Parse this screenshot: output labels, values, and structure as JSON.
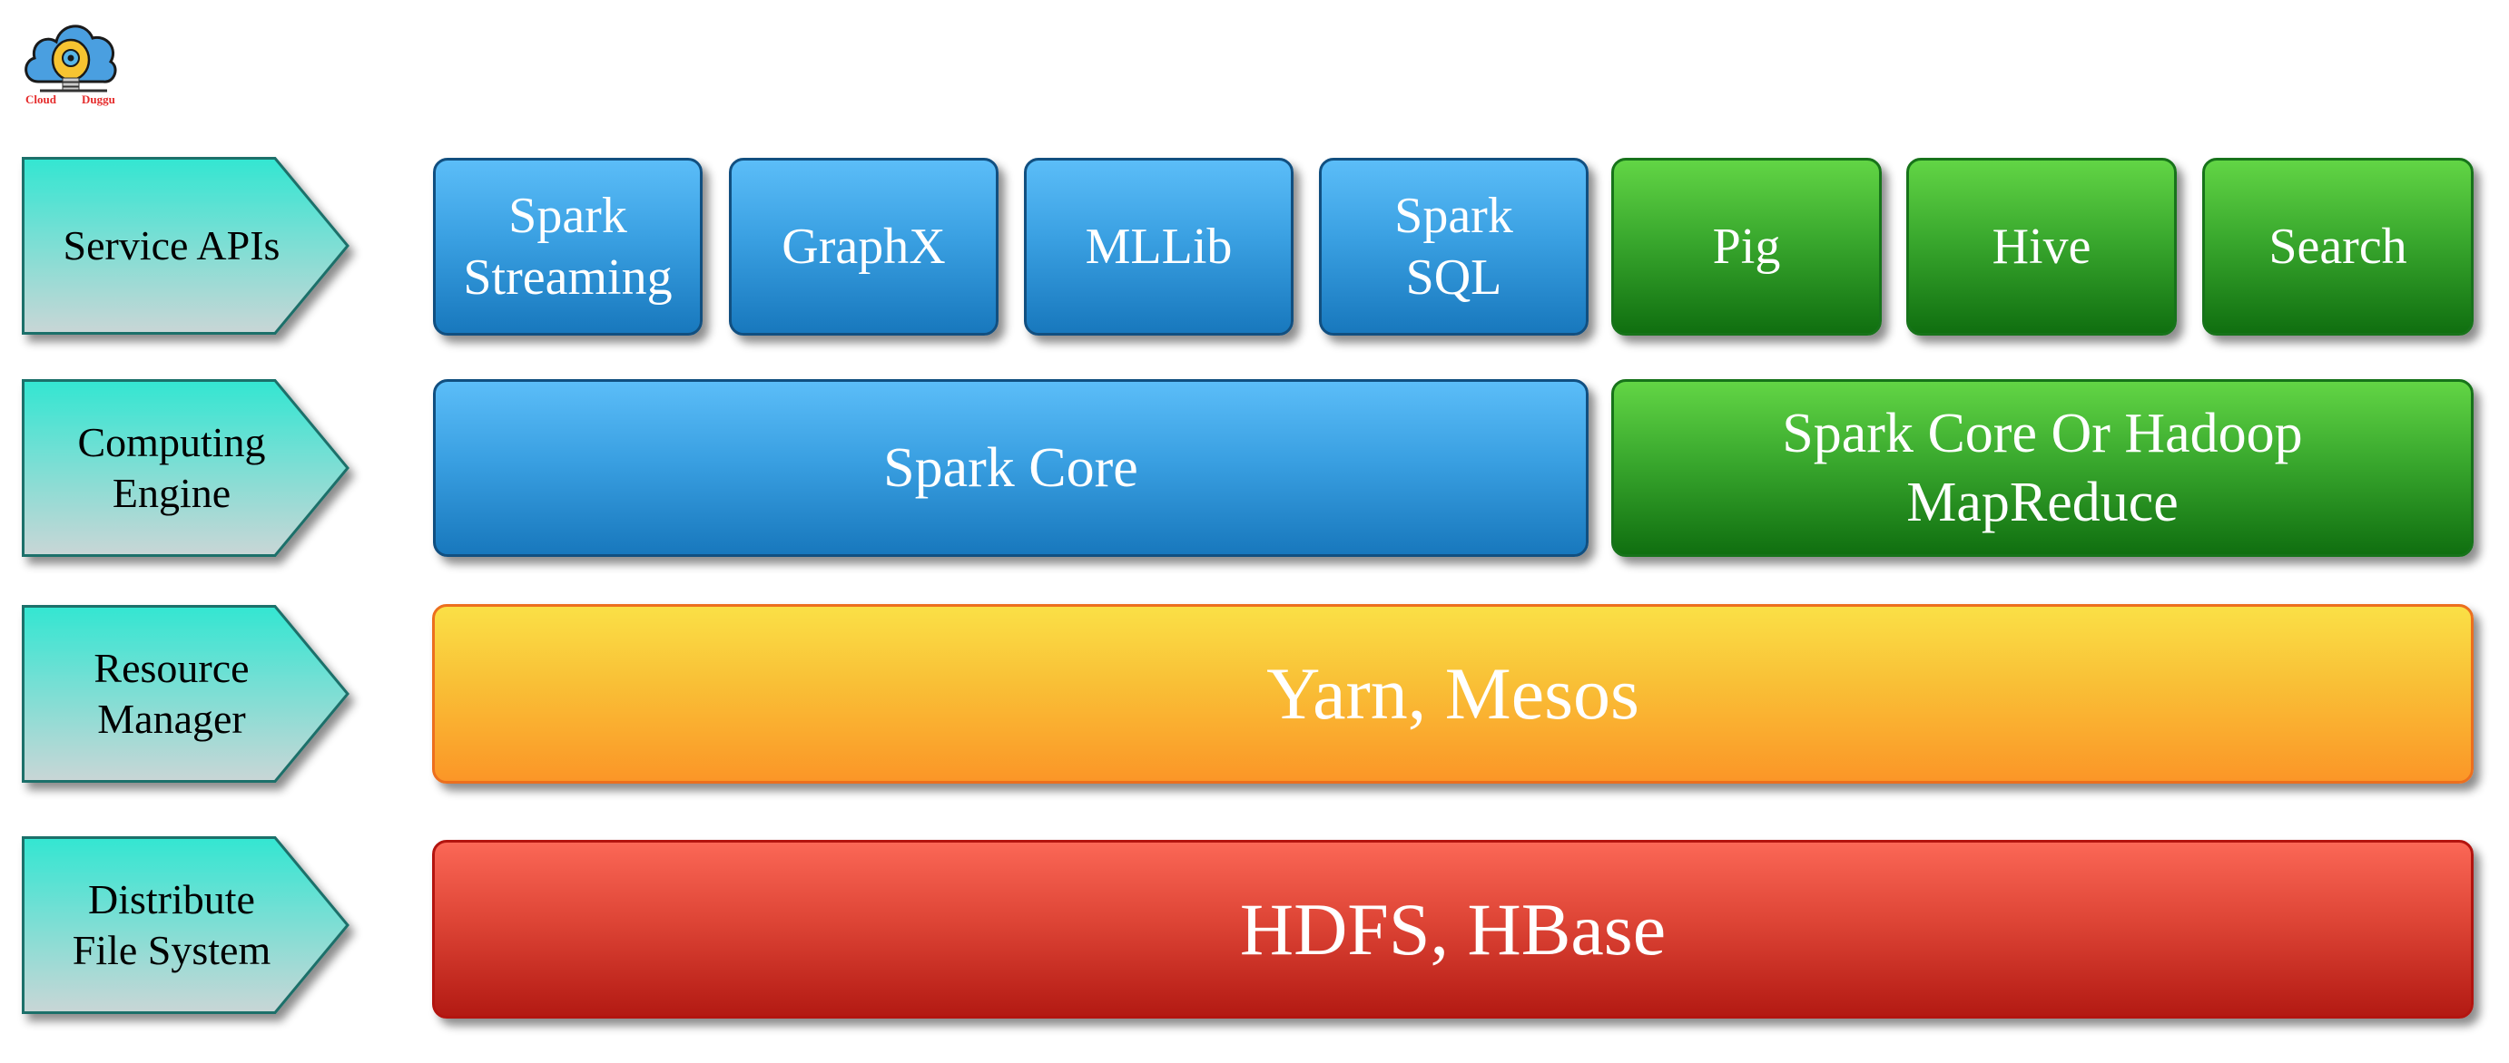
{
  "logo": {
    "text_left": "Cloud",
    "text_right": "Duggu",
    "icon": "cloud-lightbulb-logo-icon",
    "colors": {
      "cloud": "#4a9fe0",
      "bulb": "#f7c431",
      "text": "#e52b2b"
    }
  },
  "layers": [
    {
      "label": "Service APIs"
    },
    {
      "label": "Computing\nEngine"
    },
    {
      "label": "Resource\nManager"
    },
    {
      "label": "Distribute\nFile System"
    }
  ],
  "service_apis": [
    {
      "label": "Spark\nStreaming",
      "color": "blue"
    },
    {
      "label": "GraphX",
      "color": "blue"
    },
    {
      "label": "MLLib",
      "color": "blue"
    },
    {
      "label": "Spark\nSQL",
      "color": "blue"
    },
    {
      "label": "Pig",
      "color": "green"
    },
    {
      "label": "Hive",
      "color": "green"
    },
    {
      "label": "Search",
      "color": "green"
    }
  ],
  "computing_engine": [
    {
      "label": "Spark Core",
      "color": "blue"
    },
    {
      "label": "Spark Core Or Hadoop\nMapReduce",
      "color": "green"
    }
  ],
  "resource_manager": {
    "label": "Yarn, Mesos",
    "color": "yellow"
  },
  "file_system": {
    "label": "HDFS, HBase",
    "color": "red"
  },
  "colors": {
    "blue": "#2f93d8",
    "green": "#36a22c",
    "yellow": "#f9bf36",
    "red": "#de4536",
    "arrow_top": "#33e6d2",
    "arrow_bottom": "#c9d6d6",
    "arrow_border": "#1f6f6a"
  }
}
